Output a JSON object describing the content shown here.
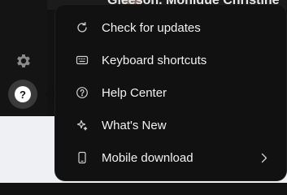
{
  "header": {
    "user_name": "Gleeson, Monique Christine"
  },
  "rail": {
    "settings_icon": "gear-icon",
    "help_icon": "help-icon",
    "help_glyph": "?"
  },
  "help_menu": {
    "items": [
      {
        "label": "Check for updates",
        "icon": "refresh-icon"
      },
      {
        "label": "Keyboard shortcuts",
        "icon": "keyboard-icon"
      },
      {
        "label": "Help Center",
        "icon": "question-circle-icon"
      },
      {
        "label": "What's New",
        "icon": "sparkle-icon"
      },
      {
        "label": "Mobile download",
        "icon": "mobile-phone-icon",
        "has_submenu": true
      }
    ]
  },
  "colors": {
    "menu_bg": "#111111",
    "text": "#f2f2f2",
    "icon": "#d0d0d0"
  }
}
